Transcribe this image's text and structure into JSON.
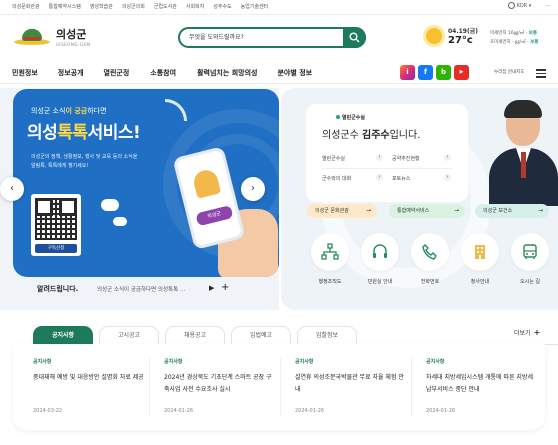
{
  "util": {
    "links": [
      "의성문화관광",
      "통합예약시스템",
      "영성학습관",
      "의성군의회",
      "군립도서관",
      "사회복지",
      "성주수도",
      "농업기술센터"
    ],
    "language": "KOR"
  },
  "header": {
    "logo_name": "의성군",
    "logo_en": "UISEONG-GUN",
    "search_placeholder": "무엇을 도와드릴까요?",
    "weather_date": "04.19(금)",
    "weather_temp": "27°c",
    "fine_dust_label": "미세먼지 16㎍/㎥ -",
    "fine_dust_value": "보통",
    "ultrafine_label": "초미세먼지 - ㎍/㎥ -",
    "ultrafine_value": "보통"
  },
  "nav": {
    "items": [
      "민원정보",
      "정보공개",
      "열린군정",
      "소통참여",
      "활력넘치는 희망의성",
      "분야별 정보"
    ],
    "sns": [
      "i",
      "f",
      "b",
      "▶"
    ],
    "small_link": "누리집 안내지도"
  },
  "banner": {
    "small_text_pre": "의성군 소식",
    "small_text_highlight": "이 궁금",
    "small_text_post": "하다면",
    "title_pre": "의성",
    "title_highlight": "톡톡",
    "title_post": "서비스!",
    "desc": "의성군의 정책, 생활정보, 행사 및 교육 등의 소식을 알림톡, 톡톡에게 챙기세요!",
    "qr_label": "구독신청",
    "phone_label": "의성군",
    "prev": "‹",
    "next": "›"
  },
  "notice": {
    "title": "알려드립니다.",
    "content": "의성군 소식이 궁금하다면 의성톡톡 …",
    "play": "▶",
    "plus": "+"
  },
  "mayor": {
    "tag": "열린군수실",
    "title_pre": "의성군수",
    "name": "김주수",
    "title_post": "입니다.",
    "links": [
      "열린군수실",
      "공약추진현황",
      "군수와의 대화",
      "포토뉴스"
    ],
    "pills": [
      {
        "label": "의성군 문화관광",
        "bg": "#fde9c8"
      },
      {
        "label": "통합예약서비스",
        "bg": "#d9f2e2"
      },
      {
        "label": "의성군 보건소",
        "bg": "#d6efe8"
      }
    ],
    "quick": [
      "행정조직도",
      "민원실 안내",
      "전화번호",
      "청사안내",
      "오시는 길"
    ]
  },
  "tabs": {
    "items": [
      "공지사항",
      "고시공고",
      "채용공고",
      "입법예고",
      "입찰정보"
    ],
    "active": 0,
    "more": "더보기"
  },
  "news": [
    {
      "cat": "공지사항",
      "title": "중대재해 예방 및 대응방안 설명회 자료 제공",
      "date": "2024-03-22"
    },
    {
      "cat": "공지사항",
      "title": "2024년 경상북도 기초단계 스마트 공장 구축사업 사전 수요조사 실시",
      "date": "2024-01-26"
    },
    {
      "cat": "공지사항",
      "title": "설연휴 의성조문국박물관 무료 자율 체험 안내",
      "date": "2024-01-26"
    },
    {
      "cat": "공지사항",
      "title": "차세대 지방세입시스템 개통에 따른 지방세 납부서비스 중단 안내",
      "date": "2024-01-26"
    }
  ]
}
